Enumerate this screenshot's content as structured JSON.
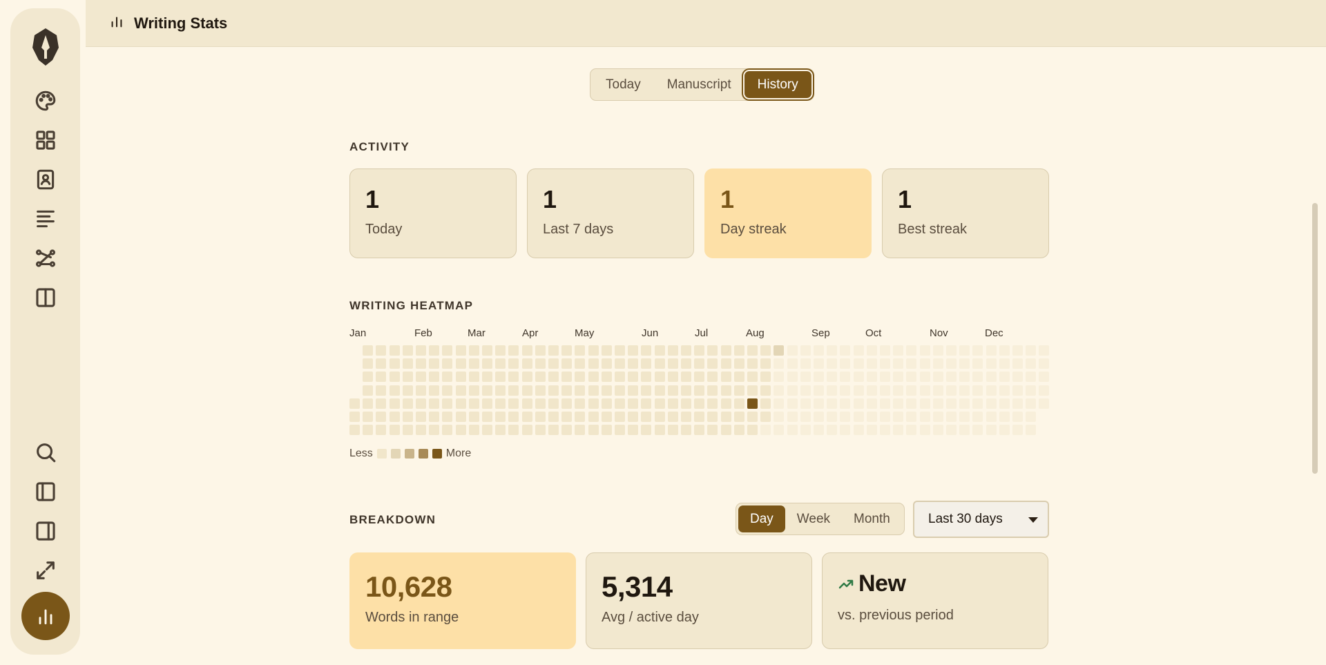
{
  "header": {
    "title": "Writing Stats",
    "icon": "bar-chart-icon"
  },
  "sidebar": {
    "logo": "quill-logo",
    "top_icons": [
      "palette-icon",
      "grid-icon",
      "contact-book-icon",
      "outline-icon",
      "graph-icon",
      "split-view-icon"
    ],
    "bottom_icons": [
      "search-icon",
      "left-panel-icon",
      "right-panel-icon",
      "expand-icon",
      "stats-icon"
    ]
  },
  "view_tabs": {
    "items": [
      "Today",
      "Manuscript",
      "History"
    ],
    "selected": "History"
  },
  "activity": {
    "title": "ACTIVITY",
    "cards": [
      {
        "value": "1",
        "label": "Today"
      },
      {
        "value": "1",
        "label": "Last 7 days"
      },
      {
        "value": "1",
        "label": "Day streak",
        "highlight": true
      },
      {
        "value": "1",
        "label": "Best streak"
      }
    ]
  },
  "heatmap": {
    "title": "WRITING HEATMAP",
    "months": [
      "Jan",
      "Feb",
      "Mar",
      "Apr",
      "May",
      "Jun",
      "Jul",
      "Aug",
      "Sep",
      "Oct",
      "Nov",
      "Dec"
    ],
    "legend_less": "Less",
    "legend_more": "More",
    "colors": [
      "#f1e6ca",
      "#e3d6b6",
      "#c9b48a",
      "#a88a56",
      "#7a5618"
    ],
    "active_days": [
      {
        "week": 30,
        "day": 4,
        "level": 4
      },
      {
        "week": 32,
        "day": 0,
        "level": 1
      }
    ]
  },
  "breakdown": {
    "title": "BREAKDOWN",
    "granularity": {
      "items": [
        "Day",
        "Week",
        "Month"
      ],
      "selected": "Day"
    },
    "range": "Last 30 days",
    "cards": [
      {
        "value": "10,628",
        "label": "Words in range",
        "highlight": true
      },
      {
        "value": "5,314",
        "label": "Avg / active day"
      },
      {
        "value": "New",
        "label": "vs. previous period",
        "trend": "up"
      }
    ]
  }
}
